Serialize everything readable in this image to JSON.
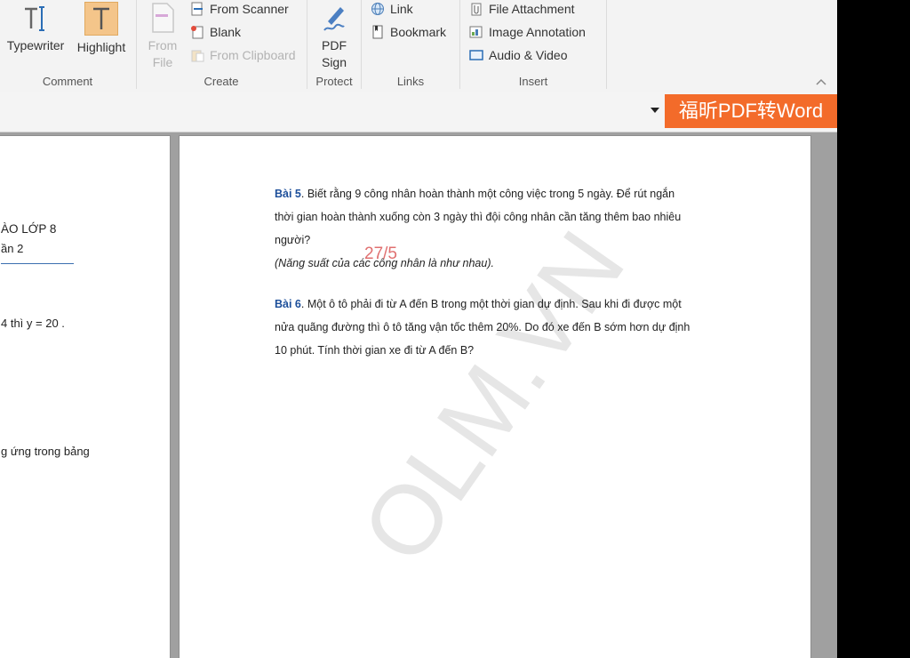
{
  "ribbon": {
    "comment": {
      "group_label": "Comment",
      "typewriter": "Typewriter",
      "highlight": "Highlight"
    },
    "create": {
      "group_label": "Create",
      "from_file_l1": "From",
      "from_file_l2": "File",
      "from_scanner": "From Scanner",
      "blank": "Blank",
      "from_clipboard": "From Clipboard"
    },
    "protect": {
      "group_label": "Protect",
      "pdf_sign_l1": "PDF",
      "pdf_sign_l2": "Sign"
    },
    "links": {
      "group_label": "Links",
      "link": "Link",
      "bookmark": "Bookmark"
    },
    "insert": {
      "group_label": "Insert",
      "file_attachment": "File Attachment",
      "image_annotation": "Image Annotation",
      "audio_video": "Audio & Video"
    },
    "collapse_icon": "chevron-up-icon"
  },
  "toolbar2": {
    "brand": "福昕PDF转Word",
    "brand_color": "#f36b2a"
  },
  "left_page": {
    "line1": "ÀO LỚP 8",
    "line2": "ần 2",
    "line3": "4  thì y = 20 .",
    "line4": "g ứng trong bảng"
  },
  "right_page": {
    "bai5_label": "Bài 5",
    "bai5_text_1": ". Biết rằng 9 công nhân hoàn thành một công việc trong 5 ngày. Để rút ngắn",
    "bai5_text_2": "thời gian hoàn thành xuống còn 3 ngày thì đội công nhân cần tăng thêm bao nhiêu",
    "bai5_text_3": "người?",
    "note": "(Năng suất của các công nhân là như nhau).",
    "annotation": "27/5",
    "bai6_label": "Bài 6",
    "bai6_text_1": ". Một ô tô phải đi từ A đến B trong một thời gian dự định. Sau khi đi được một",
    "bai6_text_2": "nửa quãng đường thì ô tô tăng vận tốc thêm 20%. Do đó xe đến B sớm hơn dự định",
    "bai6_text_3": "10 phút. Tính thời gian xe đi từ A đến B?",
    "watermark": "OLM.VN"
  }
}
